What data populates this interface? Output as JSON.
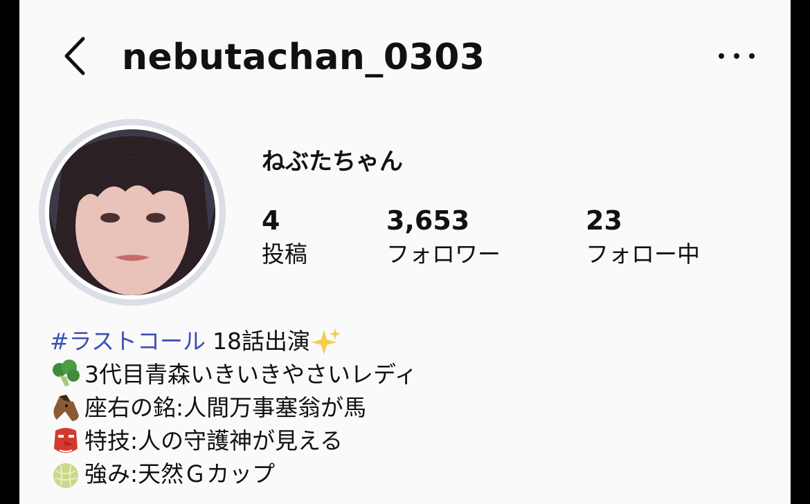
{
  "header": {
    "username": "nebutachan_0303",
    "back_icon": "chevron-left-icon",
    "more_icon": "more-horizontal-icon"
  },
  "profile": {
    "display_name": "ねぶたちゃん",
    "stats": [
      {
        "value": "4",
        "label": "投稿"
      },
      {
        "value": "3,653",
        "label": "フォロワー"
      },
      {
        "value": "23",
        "label": "フォロー中"
      }
    ]
  },
  "bio": {
    "hashtag": "#ラストコール",
    "line1_rest": "18話出演",
    "line1_emoji": "sparkles-icon",
    "lines": [
      {
        "icon": "broccoli-icon",
        "text": "3代目青森いきいきやさいレディ"
      },
      {
        "icon": "horse-face-icon",
        "text": "座右の銘:人間万事塞翁が馬"
      },
      {
        "icon": "tengu-mask-icon",
        "text": "特技:人の守護神が見える"
      },
      {
        "icon": "melon-icon",
        "text": "強み:天然Ｇカップ"
      }
    ]
  },
  "colors": {
    "hashtag": "#3a4fb8",
    "background": "#fafafa",
    "avatar_ring": "#dcdee6"
  }
}
